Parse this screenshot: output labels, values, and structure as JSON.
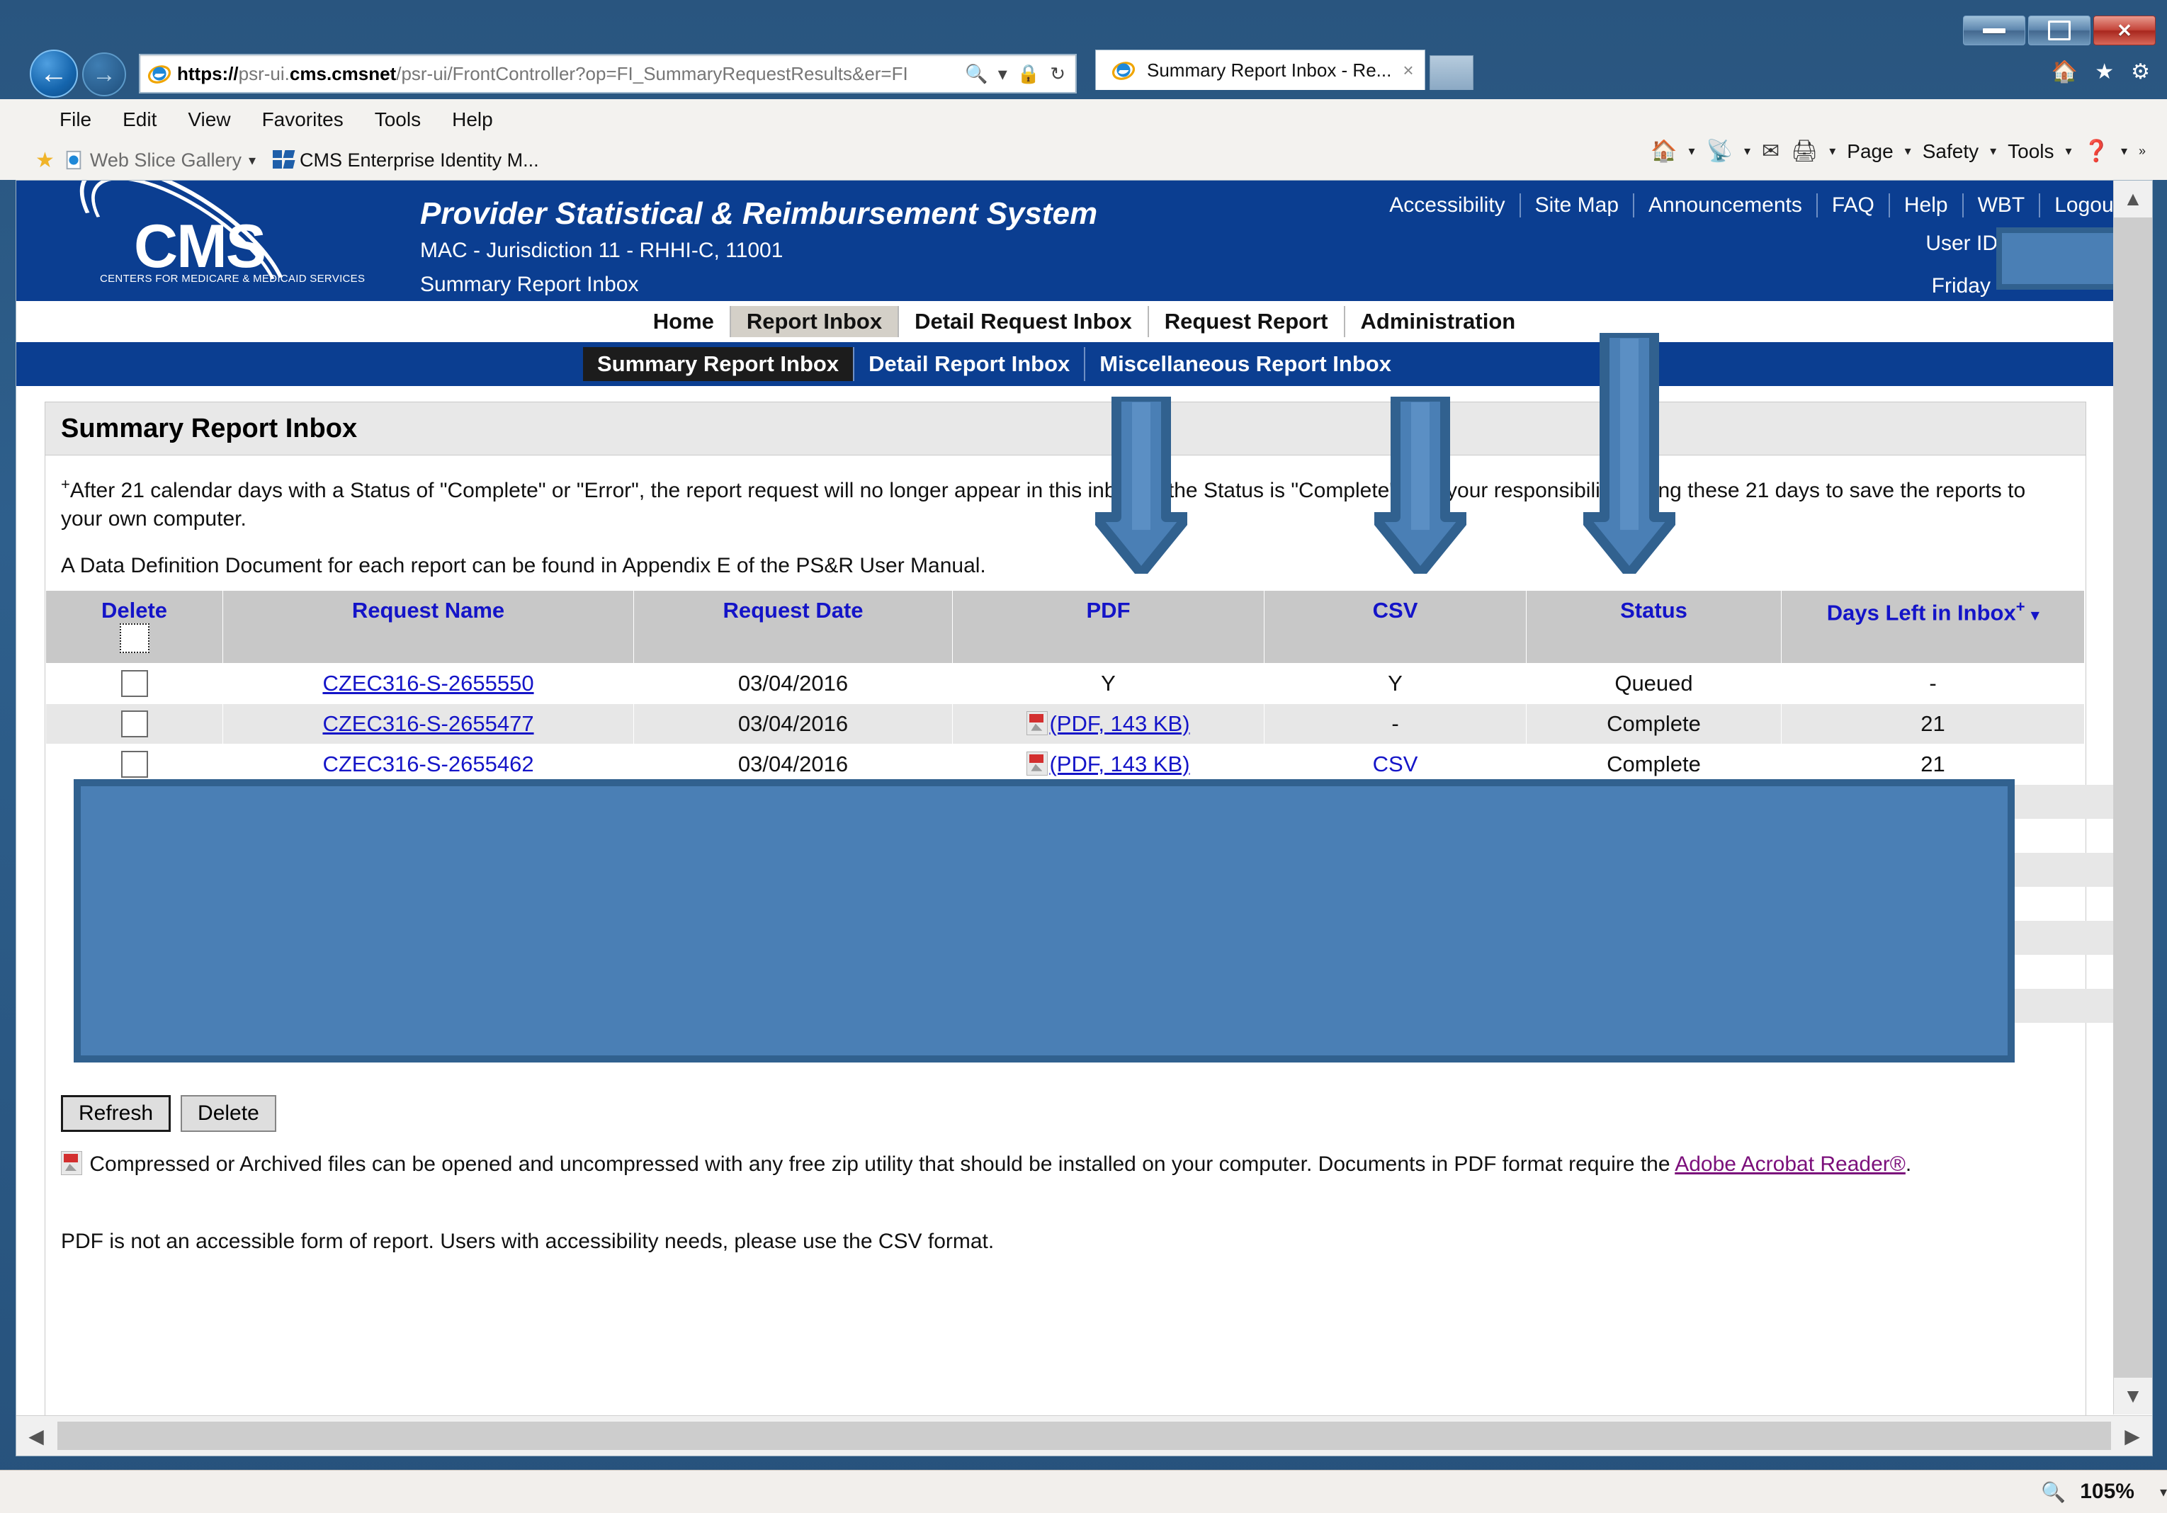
{
  "window": {
    "minimize_label": "Minimize",
    "restore_label": "Restore",
    "close_label": "Close"
  },
  "browser": {
    "url_scheme": "https://",
    "url_host_pre": "psr-ui.",
    "url_host_bold": "cms.cmsnet",
    "url_path": "/psr-ui/FrontController?op=FI_SummaryRequestResults&er=FI",
    "search_icon": "search-icon",
    "dropdown_icon": "chevron-down-icon",
    "lock_icon": "lock-icon",
    "refresh_icon": "refresh-icon",
    "tab_title": "Summary Report Inbox - Re...",
    "tab_close": "×",
    "back_icon": "back-arrow-icon",
    "forward_icon": "forward-arrow-icon",
    "home_icon": "home-icon",
    "favorites_icon": "star-icon",
    "settings_icon": "gear-icon",
    "menu": [
      "File",
      "Edit",
      "View",
      "Favorites",
      "Tools",
      "Help"
    ],
    "favorites": [
      {
        "label": "Web Slice Gallery",
        "caret": "▾"
      },
      {
        "label": "CMS Enterprise Identity M...",
        "caret": ""
      }
    ],
    "command_bar": {
      "page_label": "Page",
      "safety_label": "Safety",
      "tools_label": "Tools",
      "help_label": "?",
      "overflow": "»"
    },
    "status": {
      "zoom_level": "105%",
      "zoom_caret": "▾"
    }
  },
  "header": {
    "logo_word": "CMS",
    "logo_subtitle": "CENTERS FOR MEDICARE & MEDICAID SERVICES",
    "app_title": "Provider Statistical & Reimbursement System",
    "context_line": "MAC - Jurisdiction 11 - RHHI-C, 11001",
    "page_breadcrumb": "Summary Report Inbox",
    "links": [
      "Accessibility",
      "Site Map",
      "Announcements",
      "FAQ",
      "Help",
      "WBT",
      "Logout"
    ],
    "user_id_label": "User ID",
    "day_label": "Friday"
  },
  "nav": {
    "main": [
      {
        "label": "Home",
        "active": false
      },
      {
        "label": "Report Inbox",
        "active": true
      },
      {
        "label": "Detail Request Inbox",
        "active": false
      },
      {
        "label": "Request Report",
        "active": false
      },
      {
        "label": "Administration",
        "active": false
      }
    ],
    "sub": [
      {
        "label": "Summary Report Inbox",
        "active": true
      },
      {
        "label": "Detail Report Inbox",
        "active": false
      },
      {
        "label": "Miscellaneous Report Inbox",
        "active": false
      }
    ]
  },
  "panel": {
    "title": "Summary Report Inbox",
    "note_marker": "+",
    "note1": "After 21 calendar days with a Status of \"Complete\" or \"Error\", the report request will no longer appear in this inbox. If the Status is \"Complete\", it is your responsibility during these 21 days to save the reports to your own computer.",
    "note2": "A Data Definition Document for each report can be found in Appendix E of the PS&R User Manual."
  },
  "table": {
    "columns": [
      {
        "label": "Delete",
        "sort": ""
      },
      {
        "label": "Request Name",
        "sort": ""
      },
      {
        "label": "Request Date",
        "sort": ""
      },
      {
        "label": "PDF",
        "sort": ""
      },
      {
        "label": "CSV",
        "sort": ""
      },
      {
        "label": "Status",
        "sort": ""
      },
      {
        "label": "Days Left in Inbox",
        "sort": "▾",
        "sup": "+"
      }
    ],
    "select_all_checkbox": "unchecked",
    "rows": [
      {
        "checkbox": "unchecked",
        "request_name": "CZEC316-S-2655550",
        "request_date": "03/04/2016",
        "pdf": "Y",
        "pdf_is_link": false,
        "csv": "Y",
        "csv_is_link": false,
        "status": "Queued",
        "days_left": "-"
      },
      {
        "checkbox": "unchecked",
        "request_name": "CZEC316-S-2655477",
        "request_date": "03/04/2016",
        "pdf": "(PDF, 143 KB)",
        "pdf_is_link": true,
        "csv": "-",
        "csv_is_link": false,
        "status": "Complete",
        "days_left": "21"
      },
      {
        "checkbox": "unchecked",
        "request_name": "CZEC316-S-2655462",
        "request_date": "03/04/2016",
        "pdf": "(PDF, 143 KB)",
        "pdf_is_link": true,
        "csv": "CSV",
        "csv_is_link": true,
        "status": "Complete",
        "days_left": "21"
      }
    ]
  },
  "actions": {
    "refresh_label": "Refresh",
    "delete_label": "Delete"
  },
  "footer": {
    "pdf_icon": "pdf-icon",
    "note_a_part1": "Compressed or Archived files can be opened and uncompressed with any free zip utility that should be installed on your computer. Documents in PDF format require the",
    "note_a_link": "Adobe Acrobat Reader®",
    "note_a_period": ".",
    "note_b": "PDF is not an accessible form of report. Users with accessibility needs, please use the CSV format."
  },
  "annotations": {
    "arrow_color_fill": "#4a7fb5",
    "arrow_color_edge": "#31618f",
    "arrows": [
      {
        "target": "PDF"
      },
      {
        "target": "CSV"
      },
      {
        "target": "Status"
      }
    ],
    "redaction_color": "#4a7fb5"
  }
}
